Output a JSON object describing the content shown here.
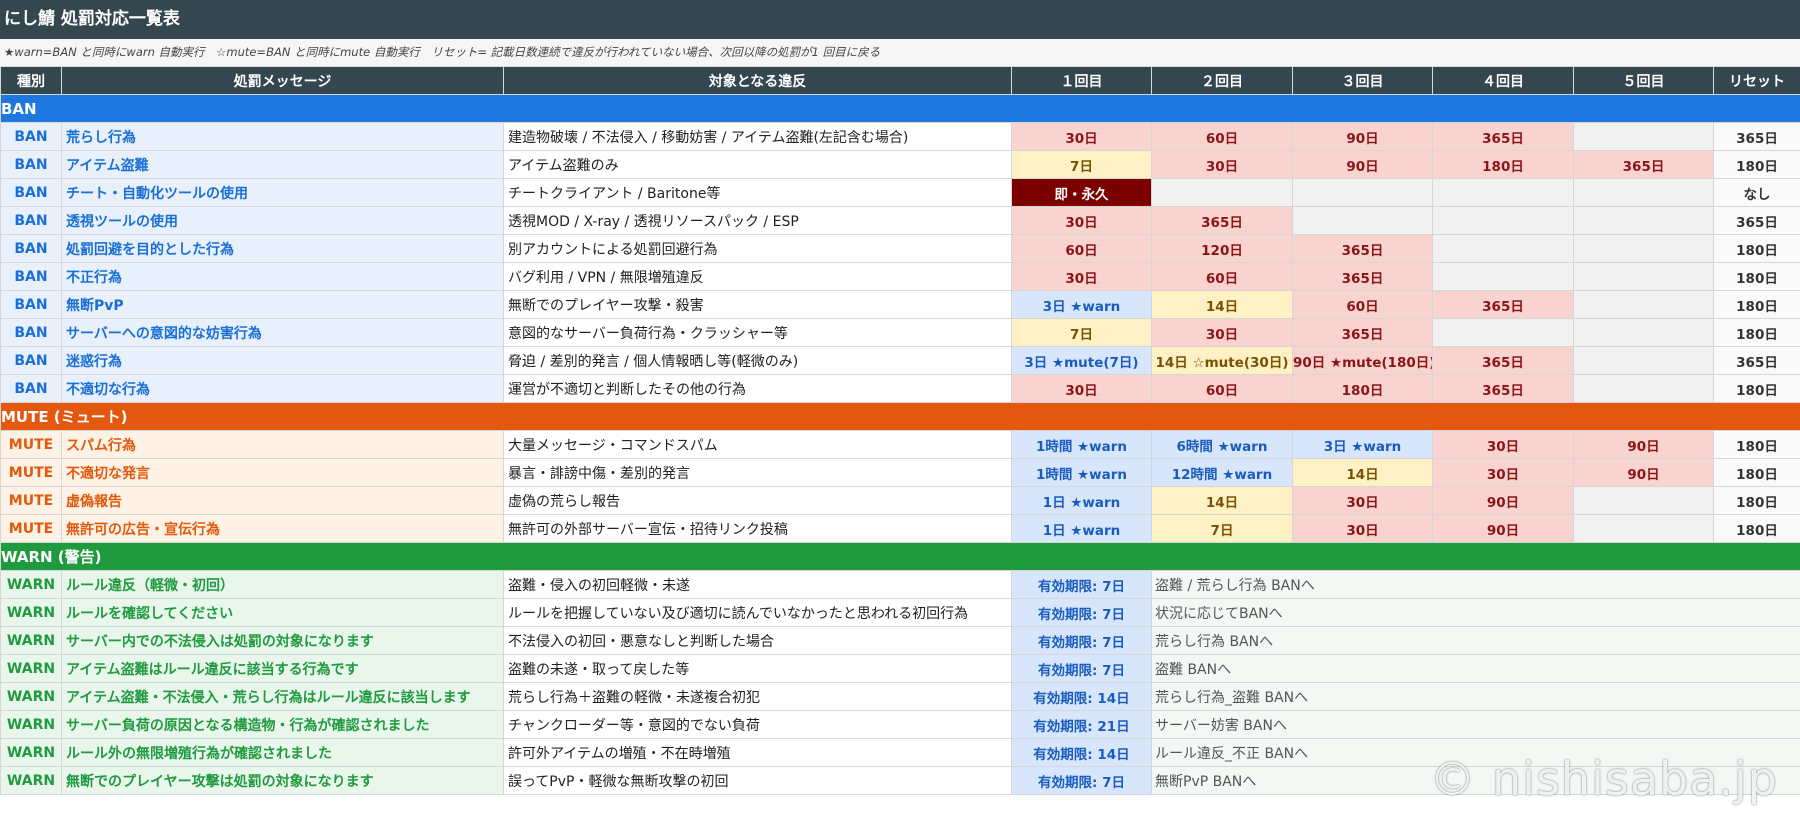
{
  "title": "にし鯖 処罰対応一覧表",
  "legend": "★warn=BAN と同時にwarn 自動実行　☆mute=BAN と同時にmute 自動実行　リセット= 記載日数連続で違反が行われていない場合、次回以降の処罰が1 回目に戻る",
  "headers": [
    "種別",
    "処罰メッセージ",
    "対象となる違反",
    "１回目",
    "２回目",
    "３回目",
    "４回目",
    "５回目",
    "リセット"
  ],
  "colors": {
    "header_bg": "#34474f",
    "ban_section": "#1f78e0",
    "mute_section": "#e3570e",
    "warn_section": "#1f9a3e",
    "penalty_red": "#f9d3d0",
    "penalty_yellow": "#fdf1c5",
    "penalty_blue": "#d7e6fa",
    "permanent": "#7b0000"
  },
  "sections": {
    "ban": {
      "label": "BAN",
      "rows": [
        {
          "kind": "BAN",
          "message": "荒らし行為",
          "violation": "建造物破壊 / 不法侵入 / 移動妨害 / アイテム盗難(左記含む場合)",
          "p": [
            "30日",
            "60日",
            "90日",
            "365日",
            ""
          ],
          "c": [
            "red",
            "red",
            "red",
            "red",
            "none"
          ],
          "reset": "365日"
        },
        {
          "kind": "BAN",
          "message": "アイテム盗難",
          "violation": "アイテム盗難のみ",
          "p": [
            "7日",
            "30日",
            "90日",
            "180日",
            "365日"
          ],
          "c": [
            "yel",
            "red",
            "red",
            "red",
            "red"
          ],
          "reset": "180日"
        },
        {
          "kind": "BAN",
          "message": "チート・自動化ツールの使用",
          "violation": "チートクライアント / Baritone等",
          "p": [
            "即・永久",
            "",
            "",
            "",
            ""
          ],
          "c": [
            "dark",
            "none",
            "none",
            "none",
            "none"
          ],
          "reset": "なし"
        },
        {
          "kind": "BAN",
          "message": "透視ツールの使用",
          "violation": "透視MOD / X-ray / 透視リソースパック / ESP",
          "p": [
            "30日",
            "365日",
            "",
            "",
            ""
          ],
          "c": [
            "red",
            "red",
            "none",
            "none",
            "none"
          ],
          "reset": "365日"
        },
        {
          "kind": "BAN",
          "message": "処罰回避を目的とした行為",
          "violation": "別アカウントによる処罰回避行為",
          "p": [
            "60日",
            "120日",
            "365日",
            "",
            ""
          ],
          "c": [
            "red",
            "red",
            "red",
            "none",
            "none"
          ],
          "reset": "180日"
        },
        {
          "kind": "BAN",
          "message": "不正行為",
          "violation": "バグ利用 / VPN / 無限増殖違反",
          "p": [
            "30日",
            "60日",
            "365日",
            "",
            ""
          ],
          "c": [
            "red",
            "red",
            "red",
            "none",
            "none"
          ],
          "reset": "180日"
        },
        {
          "kind": "BAN",
          "message": "無断PvP",
          "violation": "無断でのプレイヤー攻撃・殺害",
          "p": [
            "3日 ★warn",
            "14日",
            "60日",
            "365日",
            ""
          ],
          "c": [
            "blu",
            "yel",
            "red",
            "red",
            "none"
          ],
          "reset": "180日"
        },
        {
          "kind": "BAN",
          "message": "サーバーへの意図的な妨害行為",
          "violation": "意図的なサーバー負荷行為・クラッシャー等",
          "p": [
            "7日",
            "30日",
            "365日",
            "",
            ""
          ],
          "c": [
            "yel",
            "red",
            "red",
            "none",
            "none"
          ],
          "reset": "180日"
        },
        {
          "kind": "BAN",
          "message": "迷惑行為",
          "violation": "脅迫 / 差別的発言 / 個人情報晒し等(軽微のみ)",
          "p": [
            "3日 ★mute(7日)",
            "14日 ☆mute(30日)",
            "90日 ★mute(180日)",
            "365日",
            ""
          ],
          "c": [
            "blu",
            "yel",
            "red",
            "red",
            "none"
          ],
          "reset": "365日"
        },
        {
          "kind": "BAN",
          "message": "不適切な行為",
          "violation": "運営が不適切と判断したその他の行為",
          "p": [
            "30日",
            "60日",
            "180日",
            "365日",
            ""
          ],
          "c": [
            "red",
            "red",
            "red",
            "red",
            "none"
          ],
          "reset": "180日"
        }
      ]
    },
    "mute": {
      "label": "MUTE (ミュート)",
      "rows": [
        {
          "kind": "MUTE",
          "message": "スパム行為",
          "violation": "大量メッセージ・コマンドスパム",
          "p": [
            "1時間 ★warn",
            "6時間 ★warn",
            "3日 ★warn",
            "30日",
            "90日"
          ],
          "c": [
            "blu",
            "blu",
            "blu",
            "red",
            "red"
          ],
          "reset": "180日"
        },
        {
          "kind": "MUTE",
          "message": "不適切な発言",
          "violation": "暴言・誹謗中傷・差別的発言",
          "p": [
            "1時間 ★warn",
            "12時間 ★warn",
            "14日",
            "30日",
            "90日"
          ],
          "c": [
            "blu",
            "blu",
            "yel",
            "red",
            "red"
          ],
          "reset": "180日"
        },
        {
          "kind": "MUTE",
          "message": "虚偽報告",
          "violation": "虚偽の荒らし報告",
          "p": [
            "1日 ★warn",
            "14日",
            "30日",
            "90日",
            ""
          ],
          "c": [
            "blu",
            "yel",
            "red",
            "red",
            "none"
          ],
          "reset": "180日"
        },
        {
          "kind": "MUTE",
          "message": "無許可の広告・宣伝行為",
          "violation": "無許可の外部サーバー宣伝・招待リンク投稿",
          "p": [
            "1日 ★warn",
            "7日",
            "30日",
            "90日",
            ""
          ],
          "c": [
            "blu",
            "yel",
            "red",
            "red",
            "none"
          ],
          "reset": "180日"
        }
      ]
    },
    "warn": {
      "label": "WARN (警告)",
      "rows": [
        {
          "kind": "WARN",
          "message": "ルール違反（軽微・初回）",
          "violation": "盗難・侵入の初回軽微・未遂",
          "expiry": "有効期限: 7日",
          "note": "盗難 / 荒らし行為 BANへ"
        },
        {
          "kind": "WARN",
          "message": "ルールを確認してください",
          "violation": "ルールを把握していない及び適切に読んでいなかったと思われる初回行為",
          "expiry": "有効期限: 7日",
          "note": "状況に応じてBANへ"
        },
        {
          "kind": "WARN",
          "message": "サーバー内での不法侵入は処罰の対象になります",
          "violation": "不法侵入の初回・悪意なしと判断した場合",
          "expiry": "有効期限: 7日",
          "note": "荒らし行為 BANへ"
        },
        {
          "kind": "WARN",
          "message": "アイテム盗難はルール違反に該当する行為です",
          "violation": "盗難の未遂・取って戻した等",
          "expiry": "有効期限: 7日",
          "note": "盗難 BANへ"
        },
        {
          "kind": "WARN",
          "message": "アイテム盗難・不法侵入・荒らし行為はルール違反に該当します",
          "violation": "荒らし行為＋盗難の軽微・未遂複合初犯",
          "expiry": "有効期限: 14日",
          "note": "荒らし行為_盗難 BANへ"
        },
        {
          "kind": "WARN",
          "message": "サーバー負荷の原因となる構造物・行為が確認されました",
          "violation": "チャンクローダー等・意図的でない負荷",
          "expiry": "有効期限: 21日",
          "note": "サーバー妨害 BANへ"
        },
        {
          "kind": "WARN",
          "message": "ルール外の無限増殖行為が確認されました",
          "violation": "許可外アイテムの増殖・不在時増殖",
          "expiry": "有効期限: 14日",
          "note": "ルール違反_不正 BANへ"
        },
        {
          "kind": "WARN",
          "message": "無断でのプレイヤー攻撃は処罰の対象になります",
          "violation": "誤ってPvP・軽微な無断攻撃の初回",
          "expiry": "有効期限: 7日",
          "note": "無断PvP BANへ"
        }
      ]
    }
  },
  "watermark": "© nishisaba.jp"
}
